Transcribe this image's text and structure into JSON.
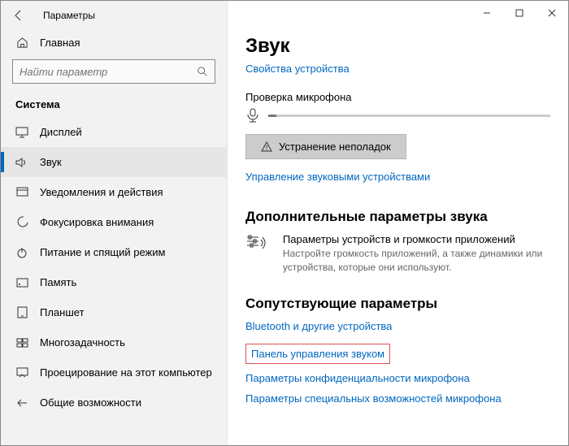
{
  "window": {
    "title": "Параметры"
  },
  "search": {
    "placeholder": "Найти параметр"
  },
  "sidebar": {
    "home": "Главная",
    "section": "Система",
    "items": [
      {
        "label": "Дисплей"
      },
      {
        "label": "Звук"
      },
      {
        "label": "Уведомления и действия"
      },
      {
        "label": "Фокусировка внимания"
      },
      {
        "label": "Питание и спящий режим"
      },
      {
        "label": "Память"
      },
      {
        "label": "Планшет"
      },
      {
        "label": "Многозадачность"
      },
      {
        "label": "Проецирование на этот компьютер"
      },
      {
        "label": "Общие возможности"
      }
    ]
  },
  "main": {
    "heading": "Звук",
    "device_props_link": "Свойства устройства",
    "mic_test_label": "Проверка микрофона",
    "troubleshoot_btn": "Устранение неполадок",
    "manage_devices_link": "Управление звуковыми устройствами",
    "advanced_heading": "Дополнительные параметры звука",
    "advanced": {
      "title": "Параметры устройств и громкости приложений",
      "desc": "Настройте громкость приложений, а также динамики или устройства, которые они используют."
    },
    "related_heading": "Сопутствующие параметры",
    "related": {
      "bluetooth": "Bluetooth и другие устройства",
      "sound_panel": "Панель управления звуком",
      "mic_privacy": "Параметры конфиденциальности микрофона",
      "mic_access": "Параметры специальных возможностей микрофона"
    }
  }
}
